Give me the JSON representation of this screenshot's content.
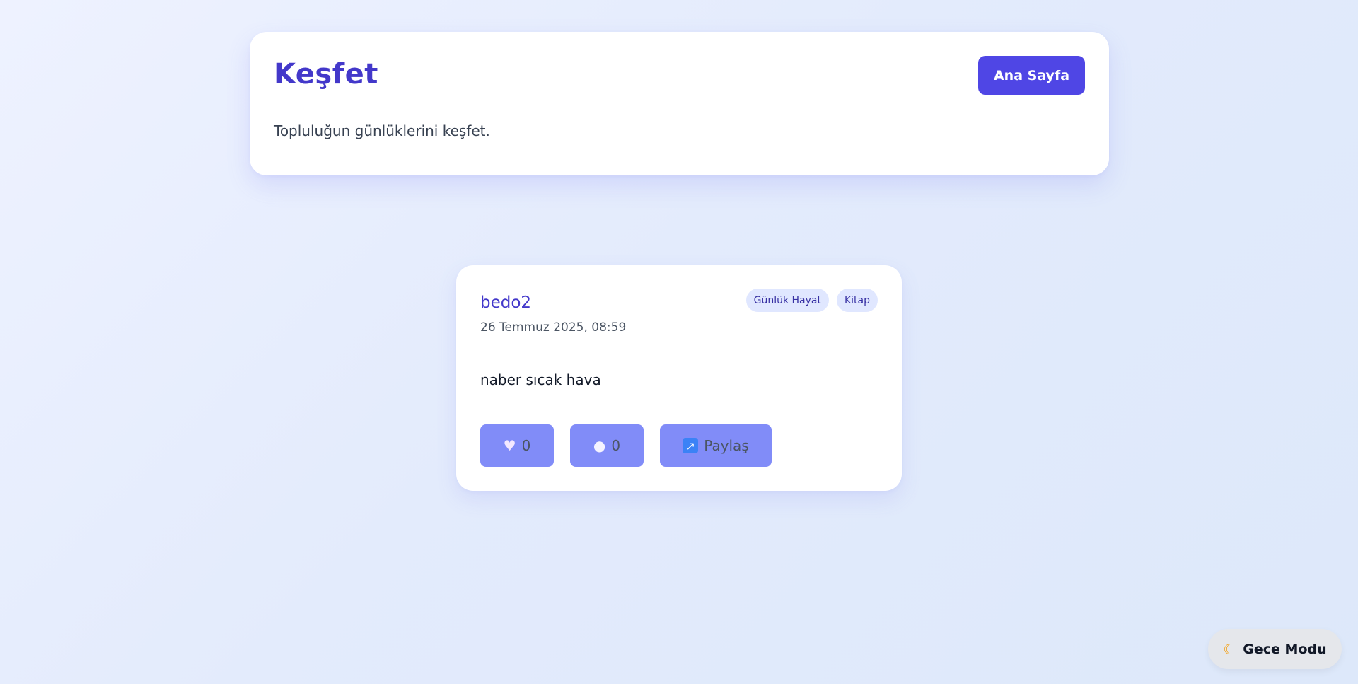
{
  "header": {
    "title": "Keşfet",
    "home_button_label": "Ana Sayfa",
    "subtitle": "Topluluğun günlüklerini keşfet."
  },
  "posts": [
    {
      "author": "bedo2",
      "date": "26 Temmuz 2025, 08:59",
      "tags": [
        "Günlük Hayat",
        "Kitap"
      ],
      "content": "naber sıcak hava",
      "likes": "0",
      "comments": "0",
      "share_label": "Paylaş",
      "icons": {
        "like": "heart-icon",
        "comment": "speech-bubble-icon",
        "share": "share-arrow-icon"
      }
    }
  ],
  "night_mode": {
    "label": "Gece Modu",
    "icon": "moon-icon"
  },
  "colors": {
    "primary": "#4f46e5",
    "title": "#4338ca",
    "action_button": "#818cf8",
    "tag_background": "#e0e7ff"
  }
}
